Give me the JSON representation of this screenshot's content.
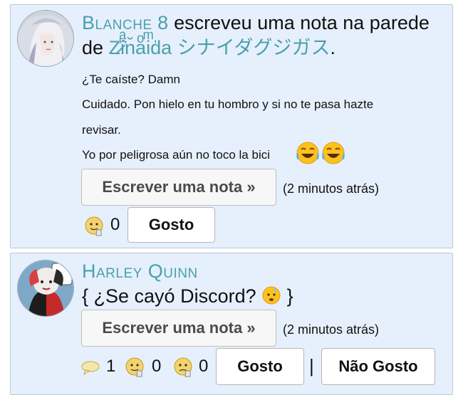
{
  "posts": [
    {
      "author": "Blanche",
      "author_suffix": "8",
      "verb": " escreveu uma nota na parede",
      "preposition": "de ",
      "target_name": "Z̷̾iͣ͛n̆aͦiͫd̍a",
      "target_katakana": "シナイダグジガス",
      "period": ".",
      "lines": [
        "¿Te caíste? Damn",
        "Cuidado. Pon hielo en tu hombro y si no te pasa hazte",
        "revisar.",
        "Yo por peligrosa aún no toco la bici"
      ],
      "write_button": "Escrever uma nota »",
      "time": "(2 minutos atrás)",
      "like_count": "0",
      "like_button": "Gosto"
    },
    {
      "author": "Harley Quinn",
      "text": "{ ¿Se cayó Discord? ",
      "text_close": " }",
      "write_button": "Escrever uma nota »",
      "time": "(2 minutos atrás)",
      "comment_count": "1",
      "like_count": "0",
      "dislike_count": "0",
      "like_button": "Gosto",
      "separator": "|",
      "dislike_button": "Não Gosto"
    }
  ],
  "icons": {
    "laugh": "face-with-tears-of-joy-icon",
    "like": "thumbs-face-icon",
    "comment": "speech-bubble-icon",
    "sweat": "anxious-face-icon"
  },
  "colors": {
    "card_bg": "#e6f0fc",
    "name": "#4aa0ad",
    "button_text": "#4b4b4b"
  }
}
